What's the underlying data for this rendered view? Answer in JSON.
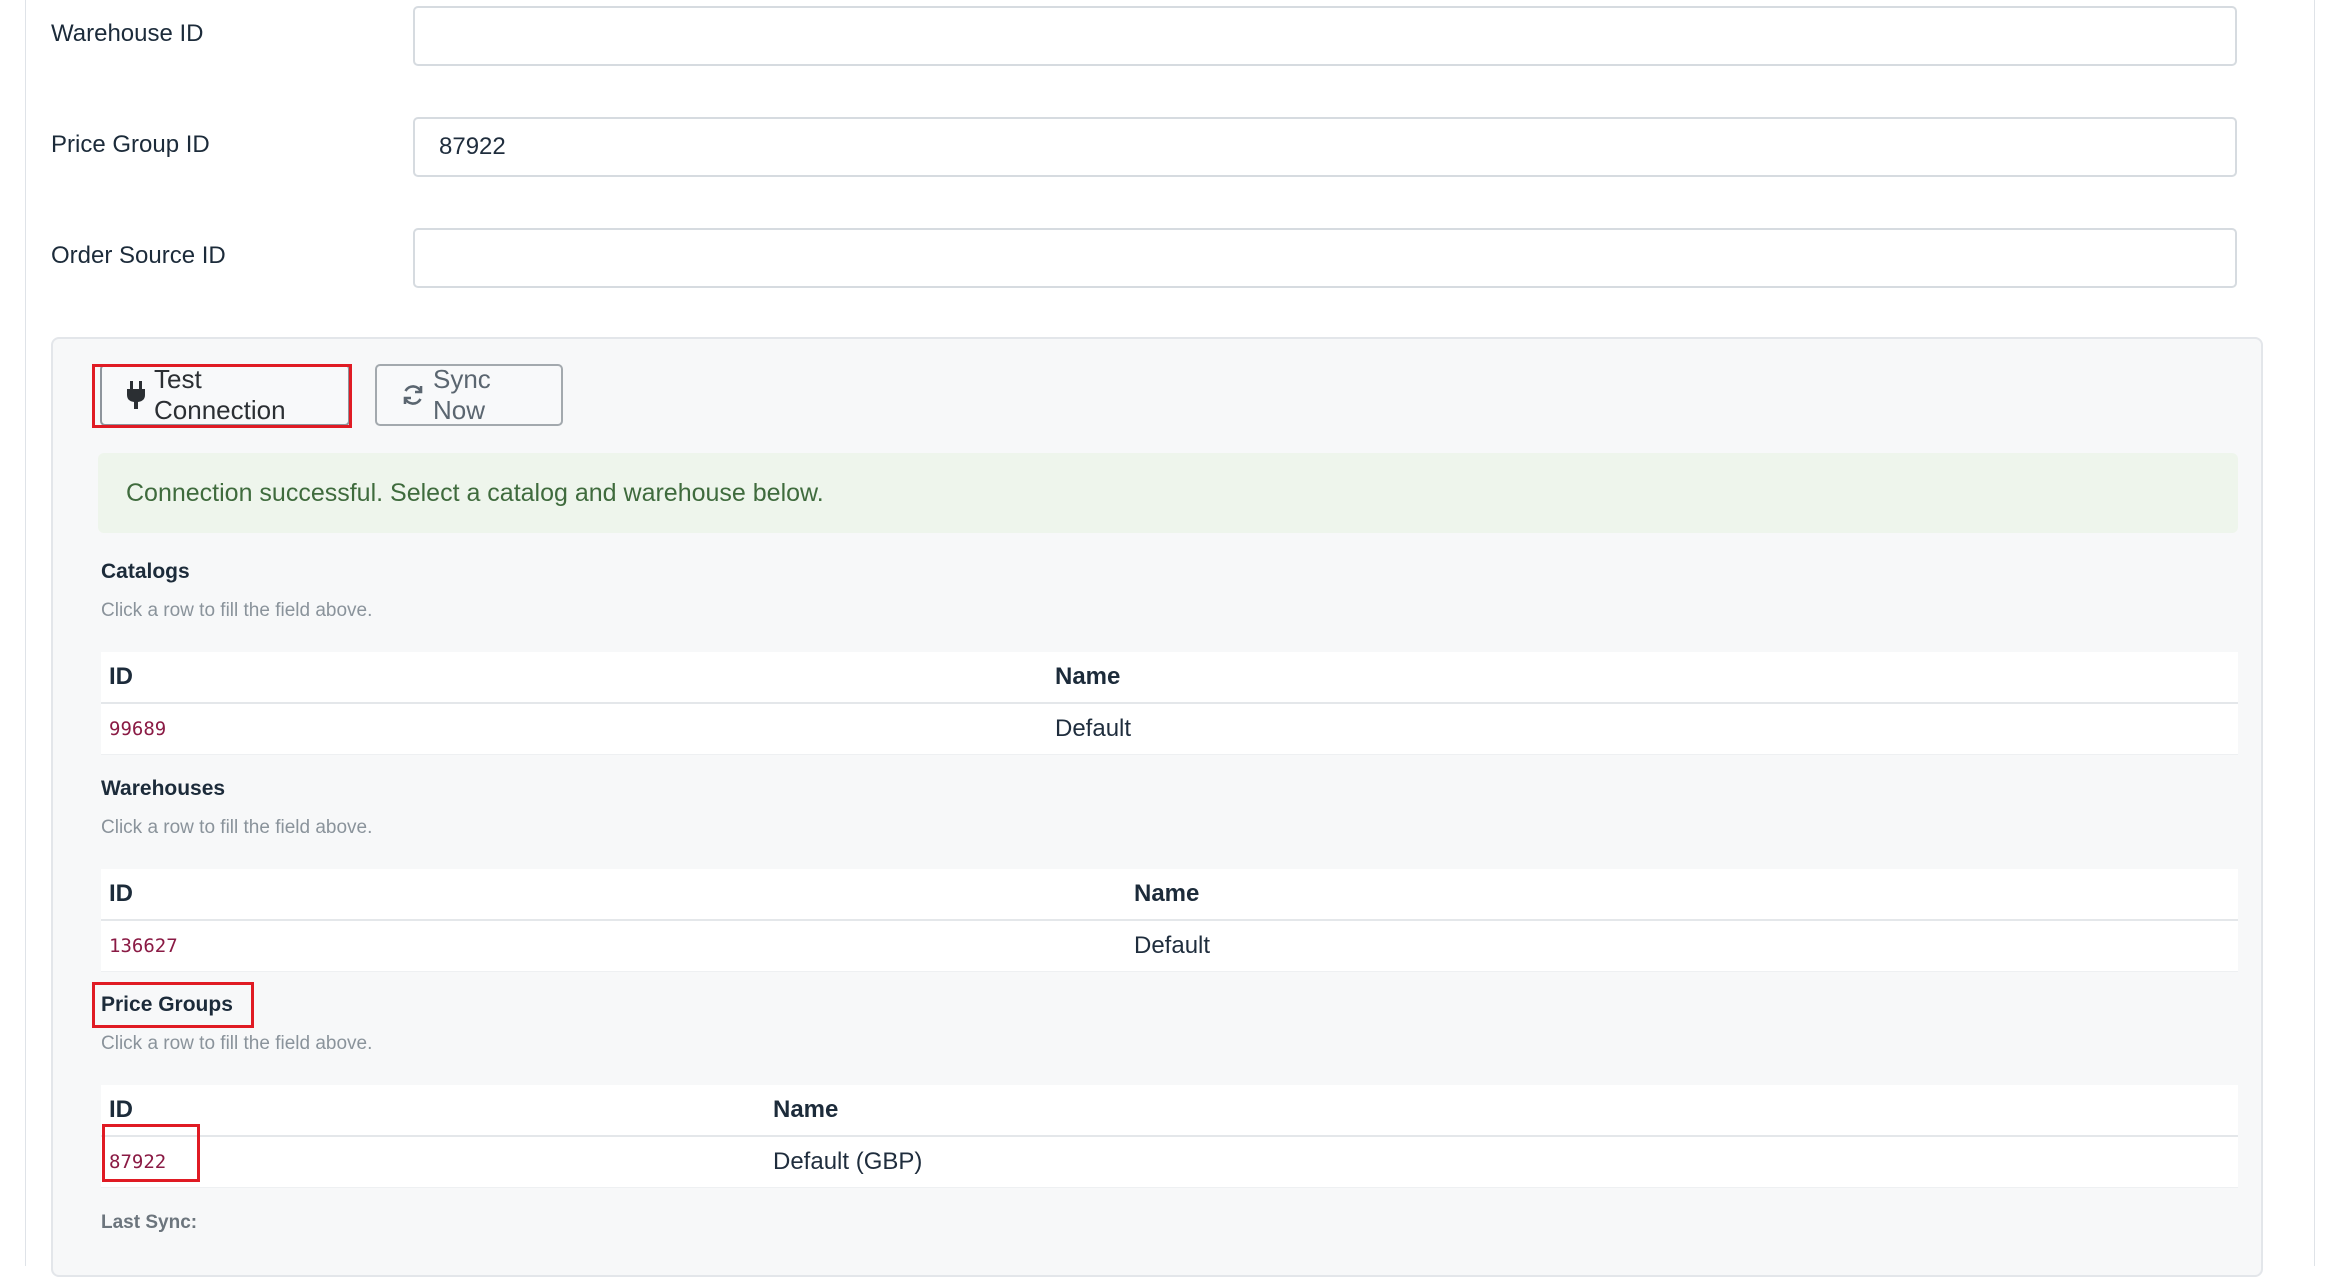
{
  "form": {
    "warehouse_id": {
      "label": "Warehouse ID",
      "value": ""
    },
    "price_group_id": {
      "label": "Price Group ID",
      "value": "87922"
    },
    "order_source_id": {
      "label": "Order Source ID",
      "value": ""
    }
  },
  "actions": {
    "test_connection": {
      "label": "Test Connection",
      "icon": "plug-icon"
    },
    "sync_now": {
      "label": "Sync Now",
      "icon": "refresh-icon"
    }
  },
  "alert": {
    "text": "Connection successful. Select a catalog and warehouse below."
  },
  "catalogs": {
    "title": "Catalogs",
    "help": "Click a row to fill the field above.",
    "columns": [
      "ID",
      "Name"
    ],
    "rows": [
      {
        "id": "99689",
        "name": "Default"
      }
    ]
  },
  "warehouses": {
    "title": "Warehouses",
    "help": "Click a row to fill the field above.",
    "columns": [
      "ID",
      "Name"
    ],
    "rows": [
      {
        "id": "136627",
        "name": "Default"
      }
    ]
  },
  "price_groups": {
    "title": "Price Groups",
    "help": "Click a row to fill the field above.",
    "columns": [
      "ID",
      "Name"
    ],
    "rows": [
      {
        "id": "87922",
        "name": "Default (GBP)"
      }
    ]
  },
  "last_sync": {
    "label": "Last Sync:"
  },
  "colors": {
    "highlight": "#e01b24",
    "success_bg": "#eef5ec",
    "success_text": "#3f6b3d",
    "mono_id": "#8a1a44"
  }
}
